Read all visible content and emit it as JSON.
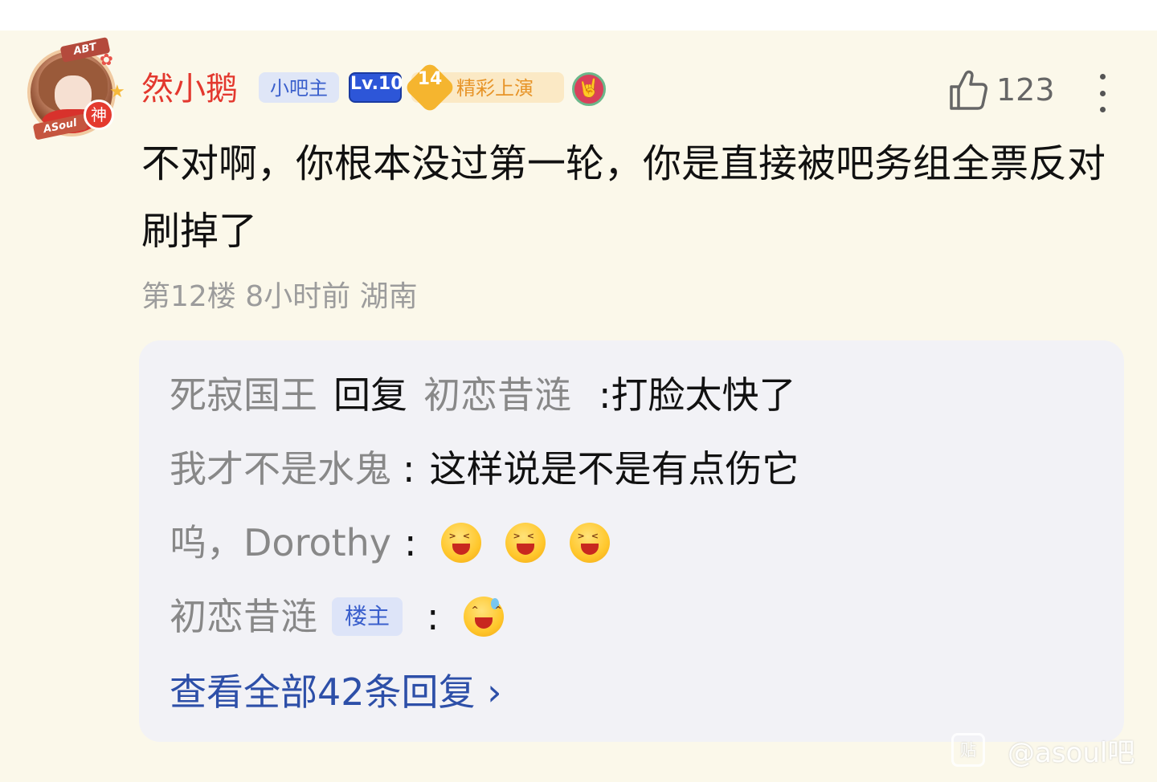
{
  "post": {
    "username": "然小鹅",
    "badges": {
      "admin": "小吧主",
      "level": "Lv.10",
      "event_number": "14",
      "event_label": "精彩上演"
    },
    "avatar": {
      "tag_top": "ABT",
      "tag_bottom": "ASoul",
      "god_label": "神"
    },
    "likes": "123",
    "comment": "不对啊，你根本没过第一轮，你是直接被吧务组全票反对刷掉了",
    "meta": "第12楼 8小时前 湖南"
  },
  "replies": [
    {
      "user": "死寂国王",
      "reply_word": "回复",
      "target": "初恋昔涟",
      "text": ":打脸太快了"
    },
    {
      "user": "我才不是水鬼",
      "colon": ":",
      "text": "这样说是不是有点伤它"
    },
    {
      "user": "呜，Dorothy",
      "colon": ":",
      "emojis": [
        "laughing-emoji",
        "laughing-emoji",
        "laughing-emoji"
      ]
    },
    {
      "user": "初恋昔涟",
      "badge": "楼主",
      "colon": ":",
      "emojis": [
        "sweat-grin-emoji"
      ]
    }
  ],
  "view_all": "查看全部42条回复 ›",
  "watermark": {
    "icon_text": "贴",
    "text": "@asoul吧"
  },
  "colors": {
    "background": "#fbf8ea",
    "username": "#e3382e",
    "link": "#2d4fa8",
    "reply_panel": "#f2f2f6"
  }
}
